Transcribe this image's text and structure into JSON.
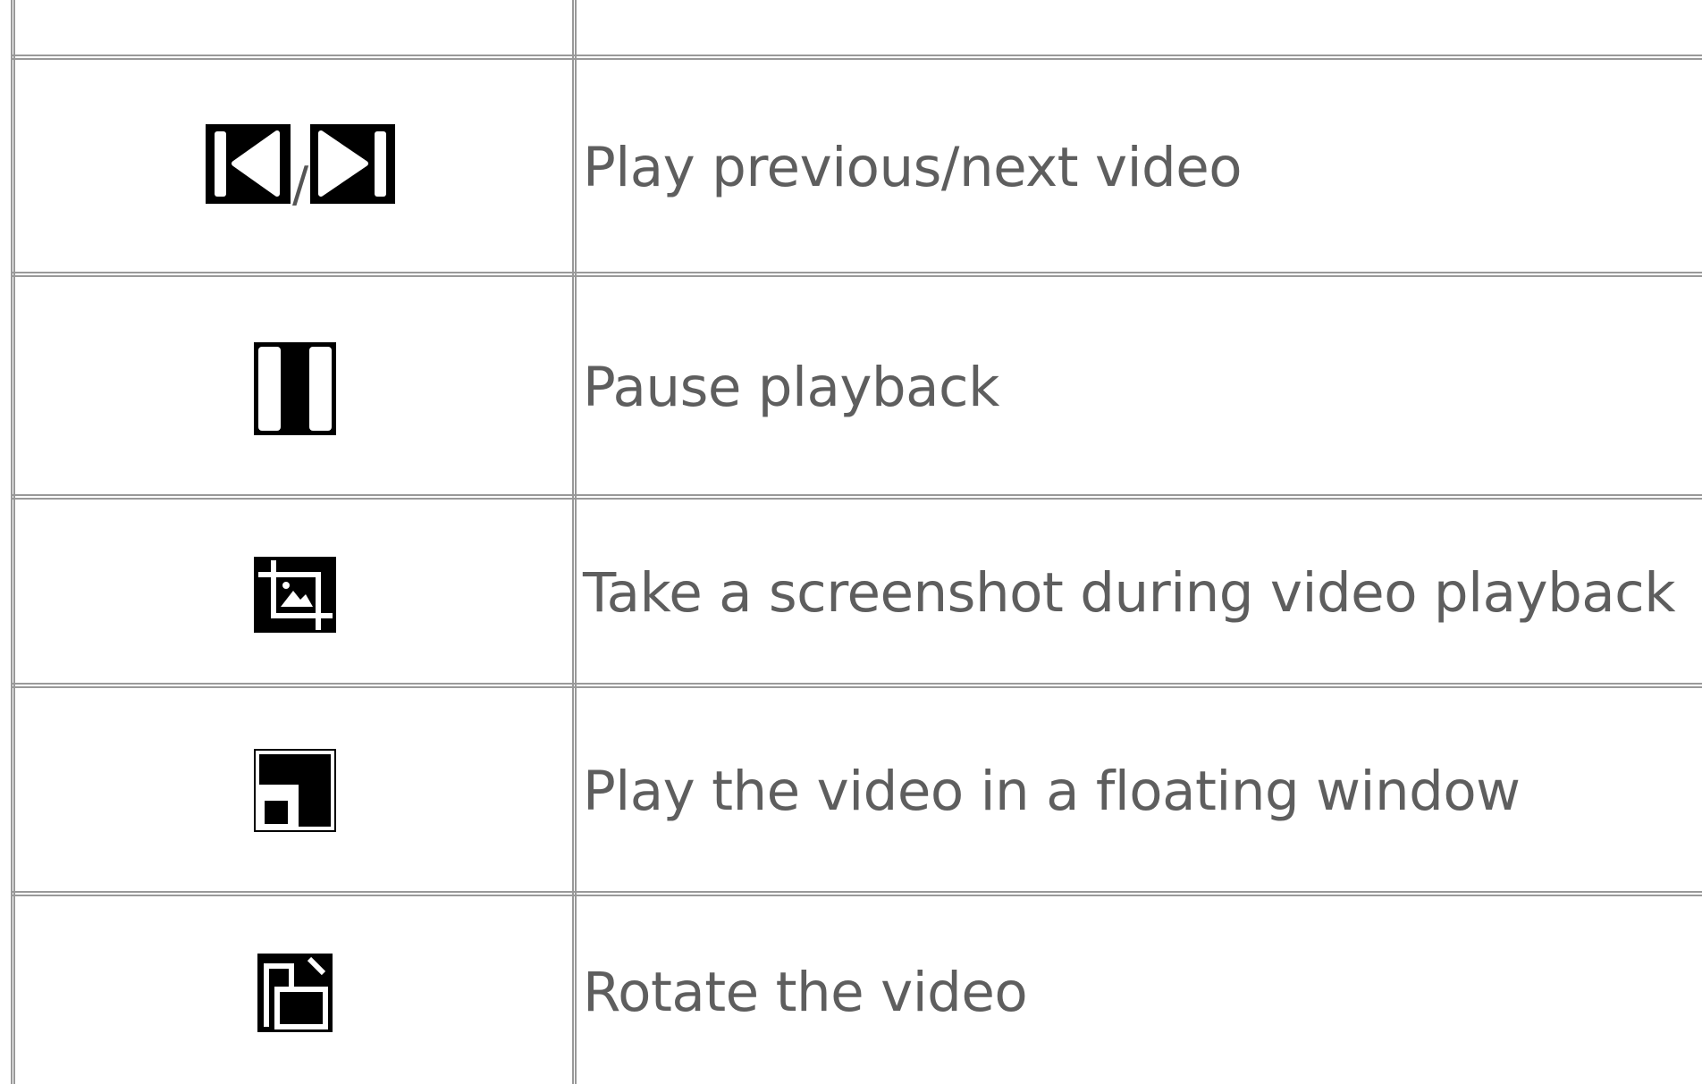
{
  "rows": [
    {
      "icon": "previous-next-icons",
      "separator": "/",
      "label": "Play previous/next video"
    },
    {
      "icon": "pause-icon",
      "label": "Pause playback"
    },
    {
      "icon": "screenshot-icon",
      "label": "Take a screenshot during video playback"
    },
    {
      "icon": "floating-window-icon",
      "label": "Play the video in a floating window"
    },
    {
      "icon": "rotate-icon",
      "label": "Rotate the video"
    }
  ]
}
